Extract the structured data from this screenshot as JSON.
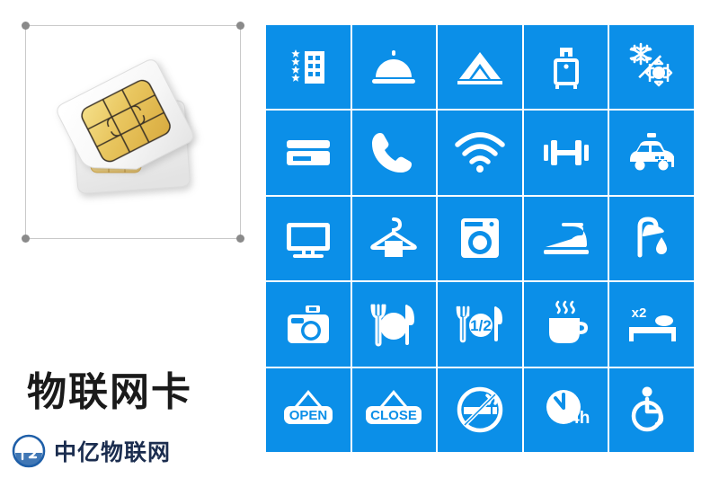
{
  "page": {
    "background_color": "#ffffff",
    "tile_color": "#0b8fe8",
    "title_color": "#1a1a1a",
    "brand_color": "#1b2d4f"
  },
  "left_panel": {
    "product_image_name": "sim-card-photo",
    "product_title": "物联网卡",
    "brand_name": "中亿物联网",
    "selection": {
      "handles": [
        "top-left",
        "top-right",
        "bottom-left",
        "bottom-right"
      ]
    }
  },
  "icon_grid": {
    "columns": 5,
    "rows": 5,
    "tiles": [
      {
        "name": "hotel-stars-icon",
        "label": "Star-rated hotel"
      },
      {
        "name": "room-service-bell-icon",
        "label": "Room service"
      },
      {
        "name": "tent-camping-icon",
        "label": "Camping / tent"
      },
      {
        "name": "luggage-icon",
        "label": "Luggage storage"
      },
      {
        "name": "air-conditioning-icon",
        "label": "Heating and cooling"
      },
      {
        "name": "credit-card-icon",
        "label": "Card payment"
      },
      {
        "name": "telephone-icon",
        "label": "Telephone"
      },
      {
        "name": "wifi-icon",
        "label": "Wi-Fi"
      },
      {
        "name": "dumbbell-icon",
        "label": "Gym / fitness"
      },
      {
        "name": "taxi-icon",
        "label": "Taxi service"
      },
      {
        "name": "television-icon",
        "label": "Television"
      },
      {
        "name": "clothes-hanger-icon",
        "label": "Wardrobe / laundry"
      },
      {
        "name": "washing-machine-icon",
        "label": "Washing machine"
      },
      {
        "name": "iron-icon",
        "label": "Iron"
      },
      {
        "name": "shower-icon",
        "label": "Shower"
      },
      {
        "name": "camera-icon",
        "label": "Camera"
      },
      {
        "name": "restaurant-icon",
        "label": "Restaurant"
      },
      {
        "name": "half-board-icon",
        "label": "Half board",
        "text": "1/2"
      },
      {
        "name": "coffee-cup-icon",
        "label": "Coffee"
      },
      {
        "name": "double-bed-icon",
        "label": "Double bed",
        "text": "x2"
      },
      {
        "name": "open-sign-icon",
        "label": "Open",
        "text": "OPEN"
      },
      {
        "name": "close-sign-icon",
        "label": "Closed",
        "text": "CLOSE"
      },
      {
        "name": "no-smoking-icon",
        "label": "No smoking"
      },
      {
        "name": "twenty-four-hour-icon",
        "label": "24 hour service",
        "text": "24h"
      },
      {
        "name": "wheelchair-access-icon",
        "label": "Wheelchair accessible"
      }
    ]
  }
}
